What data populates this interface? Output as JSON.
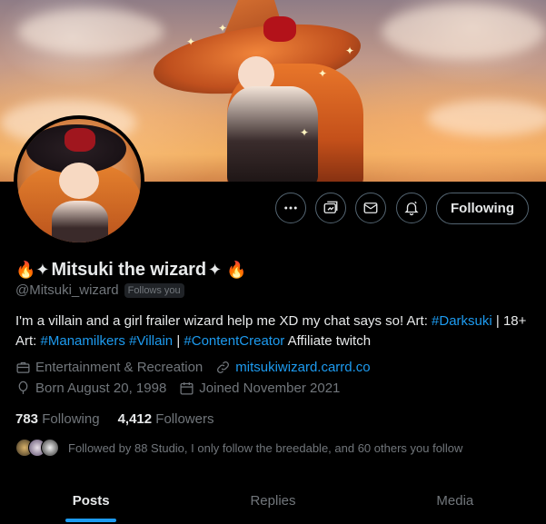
{
  "profile": {
    "name_prefix": "🔥✦",
    "name": "Mitsuki the wizard",
    "name_suffix": "✦ 🔥",
    "handle": "@Mitsuki_wizard",
    "follows_you": "Follows you",
    "bio": {
      "text1": "I'm a villain and a girl frailer wizard help me XD my chat says so! Art: ",
      "tag1": "#Darksuki",
      "text2": " | 18+ Art: ",
      "tag2": "#Manamilkers",
      "text3": " ",
      "tag3": "#Villain",
      "text4": " | ",
      "tag4": "#ContentCreator",
      "text5": " Affiliate twitch"
    },
    "category": "Entertainment & Recreation",
    "website": "mitsukiwizard.carrd.co",
    "born": "Born August 20, 1998",
    "joined": "Joined November 2021",
    "following_count": "783",
    "following_label": "Following",
    "followers_count": "4,412",
    "followers_label": "Followers",
    "followed_by": "Followed by 88 Studio, I only follow the breedable, and 60 others you follow"
  },
  "actions": {
    "more_icon": "more-horizontal-icon",
    "subscribe_icon": "media-subscribe-icon",
    "message_icon": "envelope-icon",
    "notify_icon": "bell-notification-icon",
    "follow_label": "Following"
  },
  "tabs": [
    {
      "label": "Posts",
      "active": true
    },
    {
      "label": "Replies",
      "active": false
    },
    {
      "label": "Media",
      "active": false
    }
  ],
  "colors": {
    "accent": "#1d9bf0",
    "text": "#e7e9ea",
    "muted": "#71767b",
    "background": "#000000"
  }
}
